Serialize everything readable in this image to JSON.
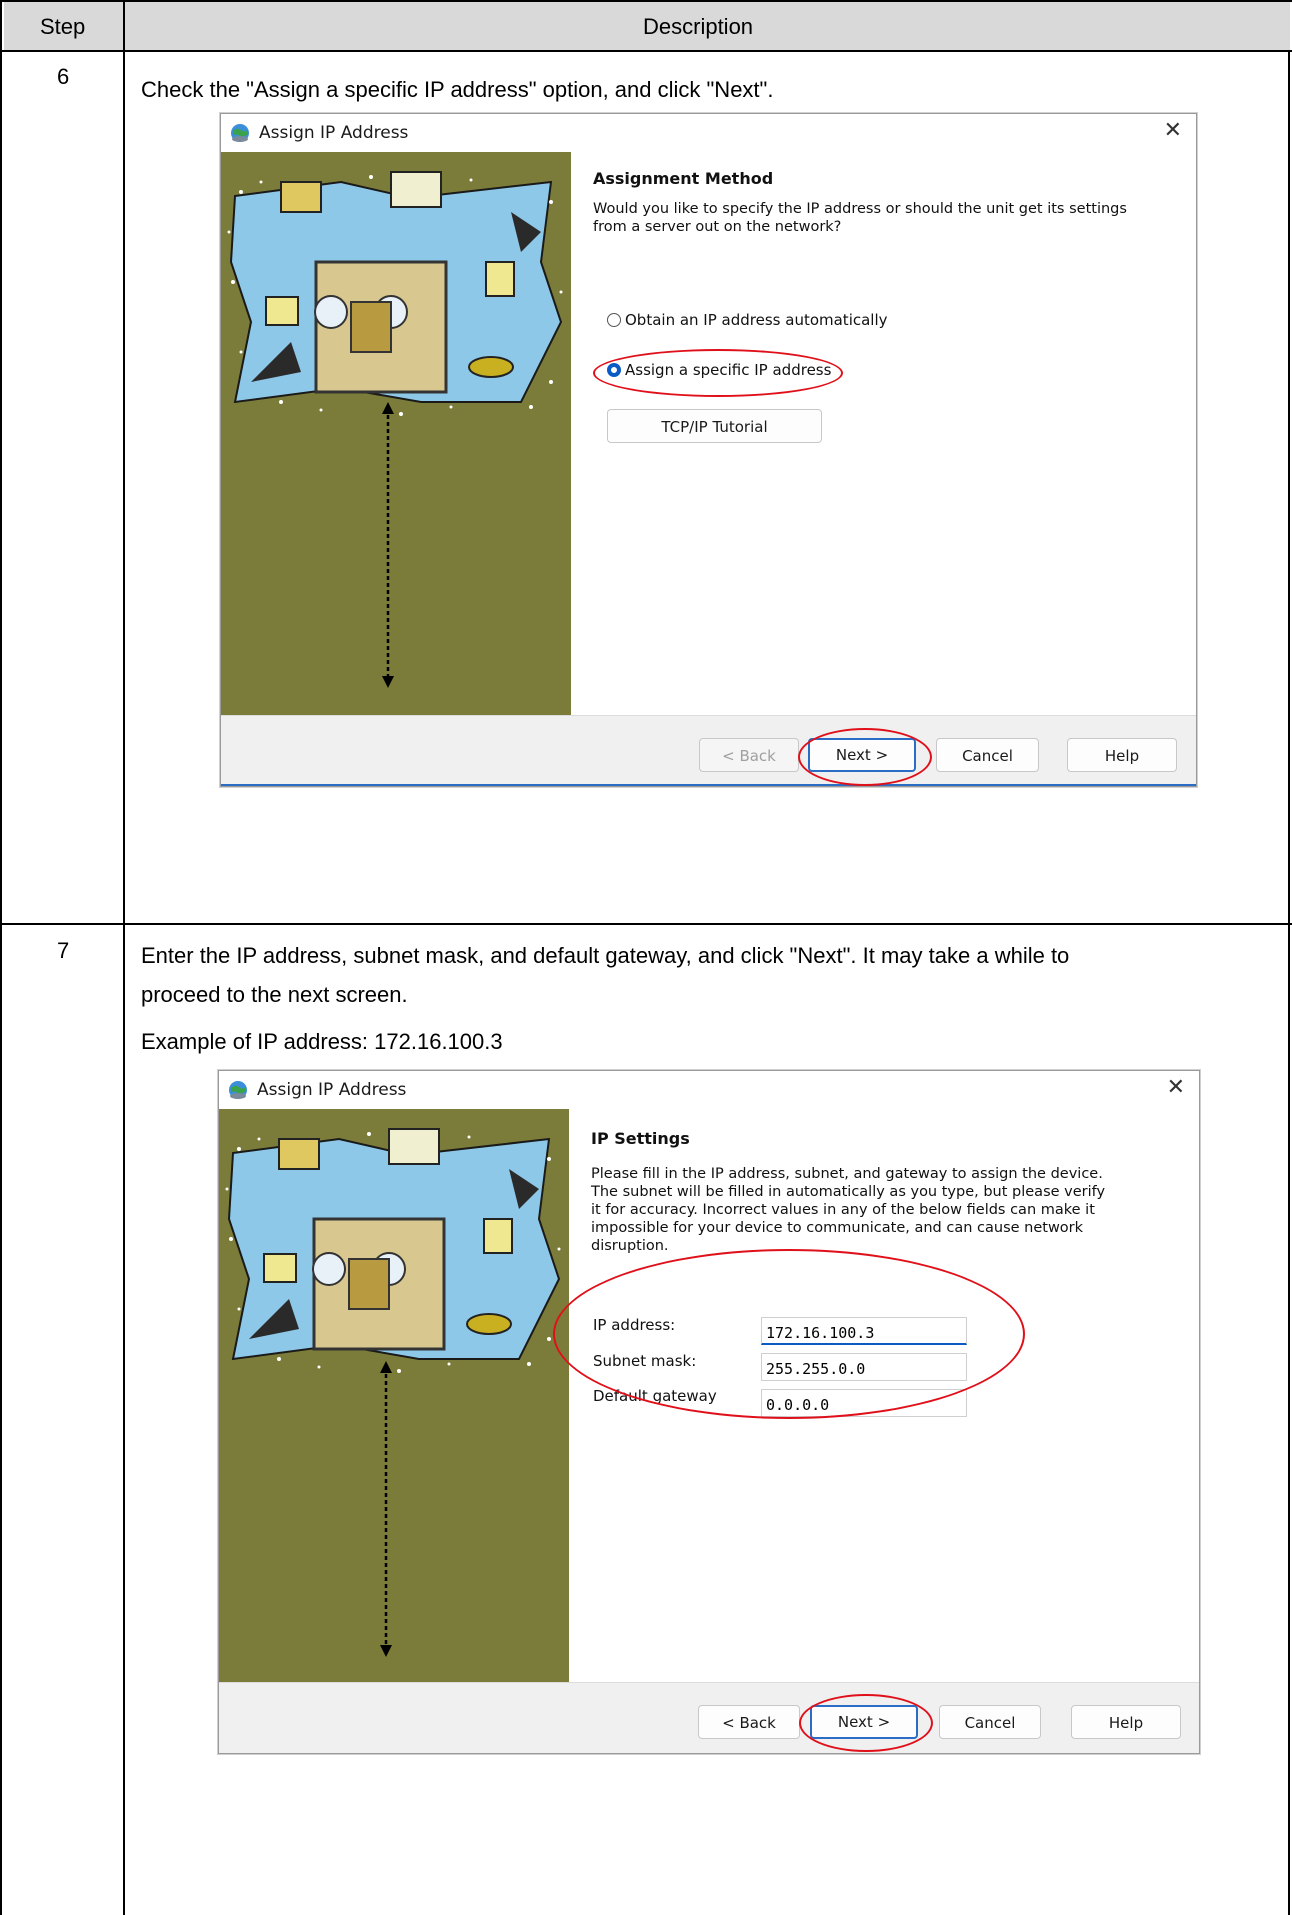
{
  "table": {
    "header": {
      "step": "Step",
      "description": "Description"
    },
    "rows": [
      {
        "step": "6",
        "description": "Check the \"Assign a specific IP address\" option, and click \"Next\".",
        "dialog": {
          "title": "Assign IP Address",
          "close_icon": "close-icon",
          "panel_title": "Assignment Method",
          "panel_text": "Would you like to specify the IP address or should the unit get its settings from a server out on the network?",
          "radio_auto": "Obtain an IP address automatically",
          "radio_specific": "Assign a specific IP address",
          "selected_option": "radio_specific",
          "tutorial_button": "TCP/IP Tutorial",
          "buttons": {
            "back": "< Back",
            "next": "Next >",
            "cancel": "Cancel",
            "help": "Help"
          },
          "back_enabled": false
        }
      },
      {
        "step": "7",
        "description_line1": "Enter the IP address, subnet mask, and default gateway, and click \"Next\". It may take a while to",
        "description_line2": "proceed to the next screen.",
        "example": "Example of IP address: 172.16.100.3",
        "dialog": {
          "title": "Assign IP Address",
          "panel_title": "IP Settings",
          "panel_text_lines": [
            "Please fill in the IP address, subnet, and gateway to assign the device.",
            "The subnet will be filled in automatically as you type, but please verify",
            "it for accuracy.  Incorrect values in any of the below fields can make it",
            "impossible for your device to communicate, and can cause network",
            "disruption."
          ],
          "fields": [
            {
              "label": "IP address:",
              "value": "172.16.100.3"
            },
            {
              "label": "Subnet mask:",
              "value": "255.255.0.0"
            },
            {
              "label": "Default gateway",
              "value": "0.0.0.0"
            }
          ],
          "buttons": {
            "back": "< Back",
            "next": "Next >",
            "cancel": "Cancel",
            "help": "Help"
          },
          "back_enabled": true
        }
      }
    ]
  },
  "colors": {
    "annotation": "#e0101a",
    "accent": "#0a5bc4",
    "art_background": "#7c7c3a",
    "header_fill": "#d9d9d9"
  }
}
